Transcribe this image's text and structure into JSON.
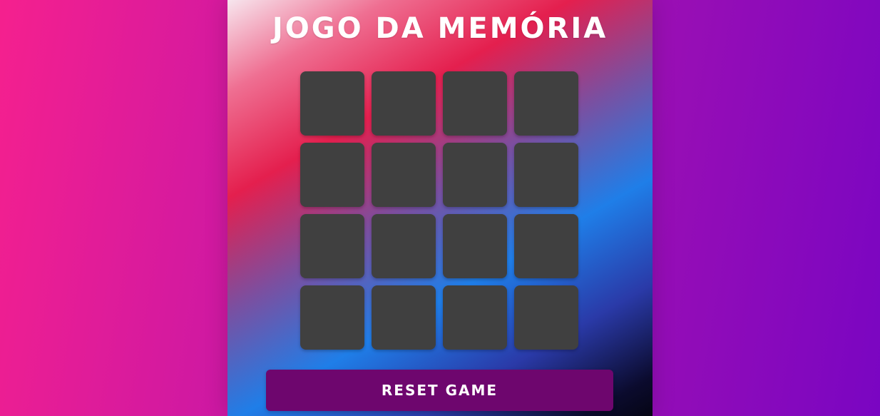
{
  "game": {
    "title": "JOGO DA MEMÓRIA",
    "reset_label": "RESET GAME",
    "card_back_color": "#404040",
    "button_color": "#6e066e",
    "cards": [
      {
        "state": "face-down"
      },
      {
        "state": "face-down"
      },
      {
        "state": "face-down"
      },
      {
        "state": "face-down"
      },
      {
        "state": "face-down"
      },
      {
        "state": "face-down"
      },
      {
        "state": "face-down"
      },
      {
        "state": "face-down"
      },
      {
        "state": "face-down"
      },
      {
        "state": "face-down"
      },
      {
        "state": "face-down"
      },
      {
        "state": "face-down"
      },
      {
        "state": "face-down"
      },
      {
        "state": "face-down"
      },
      {
        "state": "face-down"
      },
      {
        "state": "face-down"
      }
    ]
  }
}
